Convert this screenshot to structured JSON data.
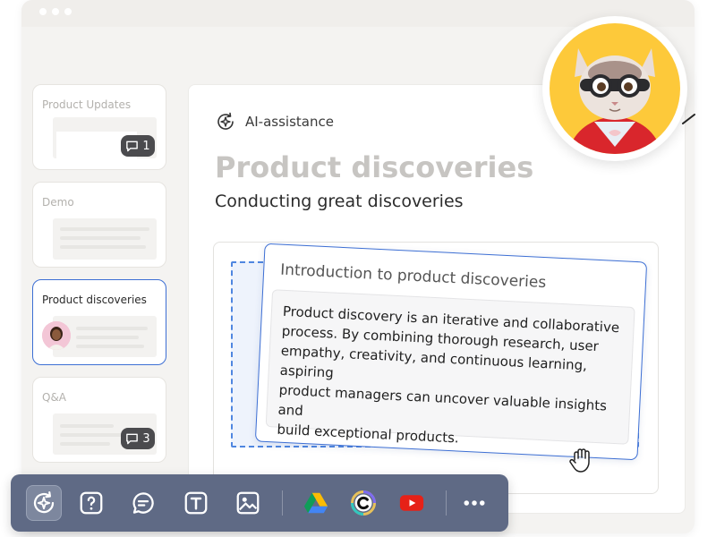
{
  "slides": [
    {
      "title": "Product Updates",
      "comment_count": "1"
    },
    {
      "title": "Demo"
    },
    {
      "title": "Product discoveries"
    },
    {
      "title": "Q&A",
      "comment_count": "3"
    }
  ],
  "main": {
    "ai_label": "AI-assistance",
    "title": "Product discoveries",
    "subtitle": "Conducting great discoveries"
  },
  "card": {
    "heading": "Introduction to product discoveries",
    "lines": [
      "Product discovery is an iterative and collaborative",
      "process. By combining thorough research, user",
      "empathy, creativity, and continuous learning, aspiring",
      "product managers can uncover valuable insights and",
      "build exceptional products."
    ]
  },
  "toolbar": {
    "tools": [
      "ai-assistant-icon",
      "question-icon",
      "chat-icon",
      "text-icon",
      "image-icon",
      "google-drive-icon",
      "canva-icon",
      "youtube-icon",
      "more-icon"
    ]
  },
  "colors": {
    "accent": "#3d6fd4",
    "toolbar": "#5f6a85",
    "mascot_bg": "#fdc93a",
    "youtube": "#e62117"
  }
}
